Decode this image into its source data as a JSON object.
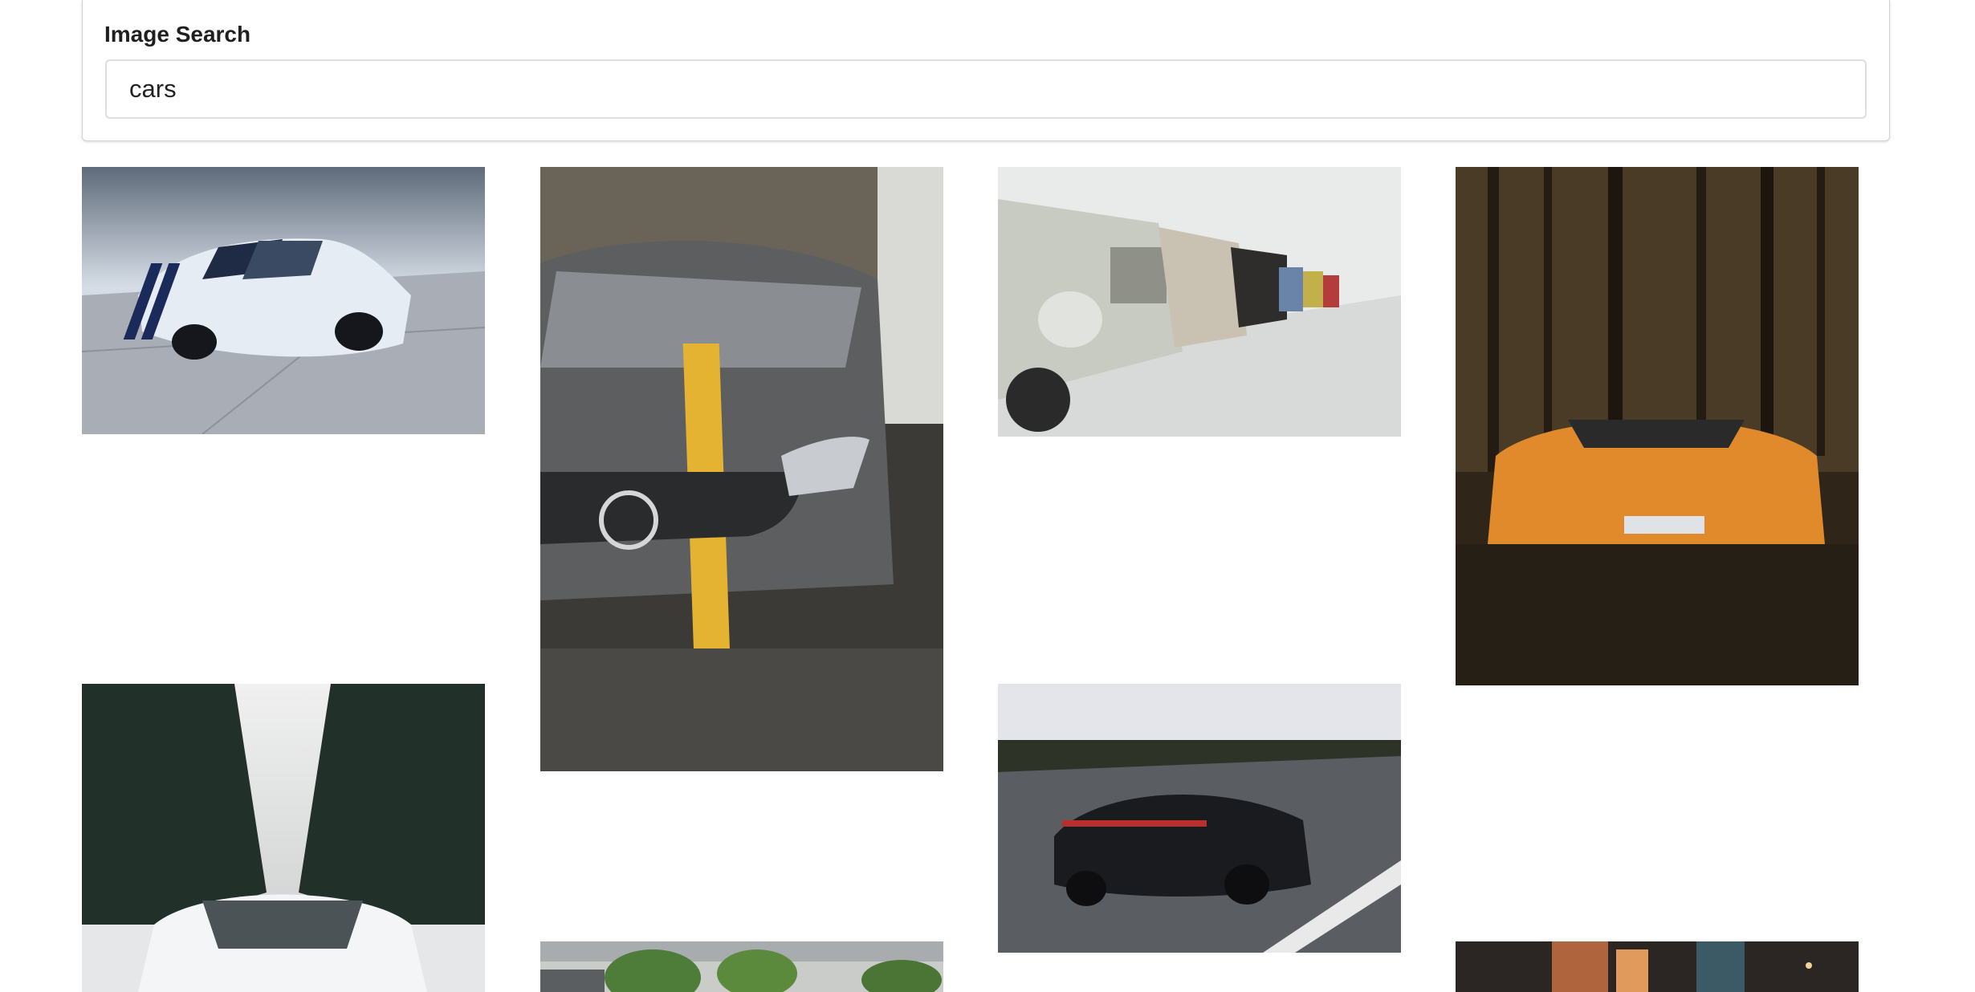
{
  "search": {
    "label": "Image Search",
    "value": "cars"
  },
  "results": [
    {
      "name": "white-mustang-photo"
    },
    {
      "name": "grey-mercedes-photo"
    },
    {
      "name": "vintage-cars-row-photo"
    },
    {
      "name": "orange-lamborghini-photo"
    },
    {
      "name": "white-car-snow-forest-photo"
    },
    {
      "name": "black-porsche-road-photo"
    },
    {
      "name": "street-trees-photo"
    },
    {
      "name": "city-night-photo"
    }
  ]
}
